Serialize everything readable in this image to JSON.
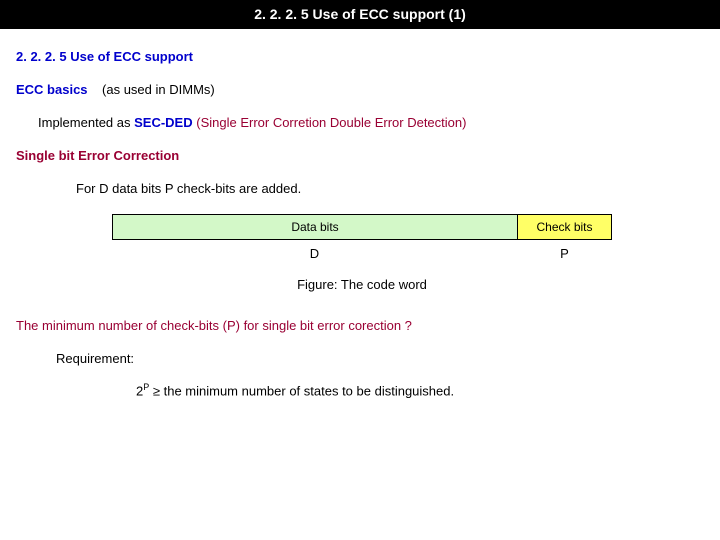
{
  "titlebar": {
    "text": "2. 2. 2. 5 Use of ECC support (1)"
  },
  "section": {
    "title": "2. 2. 2. 5 Use of ECC support"
  },
  "basics": {
    "label": "ECC basics",
    "note": "(as used in DIMMs)"
  },
  "impl": {
    "prefix": "Implemented as ",
    "secded": "SEC-DED",
    "expansion": " (Single Error Corretion Double Error Detection)"
  },
  "correction": {
    "heading": "Single bit Error Correction",
    "sentence": "For D data bits P check-bits are added."
  },
  "figure": {
    "data_bits": "Data bits",
    "check_bits": "Check bits",
    "D": "D",
    "P": "P",
    "caption": "Figure: The code word"
  },
  "question": "The minimum number of check-bits (P) for single bit  error corection ?",
  "requirement": {
    "label": "Requirement:"
  },
  "formula": {
    "two": "2",
    "exp": "P",
    "rest": " ≥ the minimum number of states to be distinguished."
  }
}
